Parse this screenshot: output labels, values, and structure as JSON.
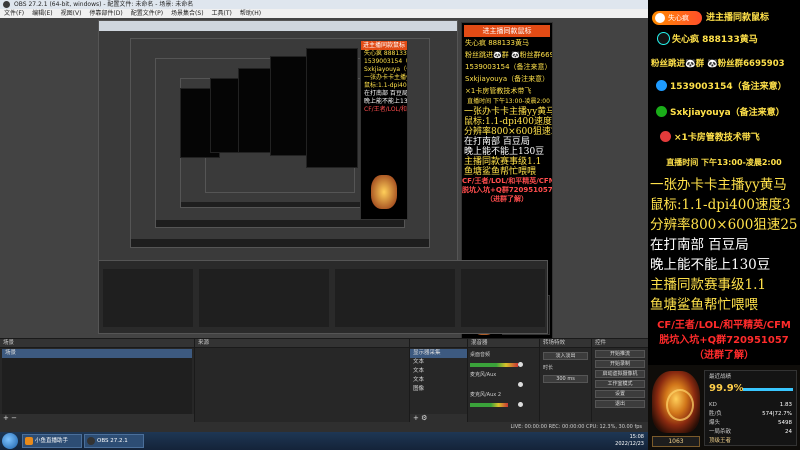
{
  "obs": {
    "title": "OBS 27.2.1 (64-bit, windows) - 配置文件: 未命名 - 场景: 未命名",
    "menu": [
      "文件(F)",
      "编辑(E)",
      "视图(V)",
      "停靠部件(D)",
      "配置文件(P)",
      "场景集合(S)",
      "工具(T)",
      "帮助(H)"
    ],
    "docks": {
      "scenes": {
        "title": "场景",
        "items": [
          "场景"
        ]
      },
      "sources": {
        "title": "来源",
        "items": [
          "显示器采集",
          "文本",
          "文本",
          "文本",
          "图像"
        ]
      },
      "mixer": {
        "title": "混音器",
        "tracks": [
          {
            "name": "桌面音频",
            "db": "0.0 dB",
            "level": 0.7
          },
          {
            "name": "麦克风/Aux",
            "db": "0.0 dB",
            "level": 0.0
          },
          {
            "name": "麦克风/Aux 2",
            "db": "0.0 dB",
            "level": 0.55
          }
        ]
      },
      "transitions": {
        "title": "转场特效",
        "type": "淡入淡出",
        "duration_label": "时长",
        "duration": "300 ms"
      },
      "controls": {
        "title": "控件",
        "buttons": [
          "开始推流",
          "开始录制",
          "启动虚拟摄像机",
          "工作室模式",
          "设置",
          "退出"
        ]
      }
    },
    "status": "LIVE: 00:00:00    REC: 00:00:00    CPU: 12.3%, 30.00 fps",
    "taskbar": {
      "apps": [
        {
          "label": "小鱼直播助手",
          "color": "#e88a1a"
        },
        {
          "label": "OBS 27.2.1",
          "color": "#333333"
        },
        {
          "label": "",
          "color": "#2c5c9a"
        }
      ],
      "time": "15:08",
      "date": "2022/12/23"
    }
  },
  "panel": {
    "badge_text": "失心疯",
    "header": "进主播同款鼠标",
    "contacts": [
      {
        "icon": "tiktok-icon",
        "color": "#111111",
        "ring": "#25f4ee",
        "text": "失心疯 888133黄马"
      },
      {
        "icon": "fans-group-icon",
        "color": "#1aad19",
        "ring": "#1aad19",
        "text": "粉丝跳进🐼群 🐼粉丝群6695903"
      },
      {
        "icon": "qq-icon",
        "color": "#1e9bff",
        "ring": "#1e9bff",
        "text": "1539003154（备注来意）"
      },
      {
        "icon": "wechat-icon",
        "color": "#1aad19",
        "ring": "#1aad19",
        "text": "Sxkjiayouya（备注来意）"
      },
      {
        "icon": "rocket-icon",
        "color": "#e23b3b",
        "ring": "#e23b3b",
        "text": "×1卡房管教技术带飞"
      }
    ],
    "live_time": "直播时间 下午13:00-凌晨2:00",
    "lines": [
      {
        "text": "一张办卡卡主播yy黄马",
        "color": "#ffe14a"
      },
      {
        "text": "鼠标:1.1-dpi400速度3",
        "color": "#ffe14a"
      },
      {
        "text": "分辨率800×600狙速25",
        "color": "#ffe14a"
      },
      {
        "text": "在打南部 百豆局",
        "color": "#ffffff"
      },
      {
        "text": "晚上能不能上130豆",
        "color": "#ffffff"
      },
      {
        "text": "主播同款赛事级1.1",
        "color": "#ffe14a"
      },
      {
        "text": "鱼塘鲨鱼帮忙喂喂",
        "color": "#ffe14a"
      }
    ],
    "promo": [
      "CF/王者/LOL/和平精英/CFM",
      "脱坑入坑+Q群720951057",
      "（进群了解）"
    ],
    "card": {
      "rank_label": "最近战绩",
      "win_pct": "99.9%",
      "win_fraction": 0.999,
      "stats": [
        {
          "label": "KD",
          "value": "1.83"
        },
        {
          "label": "胜/负",
          "value": "574|72.7%"
        },
        {
          "label": "爆头",
          "value": "5498"
        },
        {
          "label": "一局杀敌",
          "value": "24"
        }
      ],
      "level": "1063",
      "title": "顶级王者"
    }
  }
}
